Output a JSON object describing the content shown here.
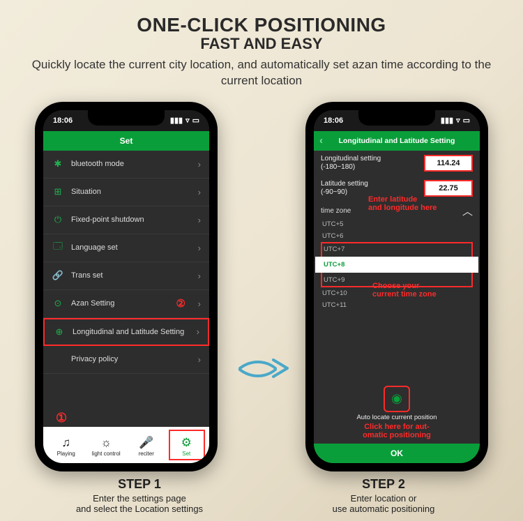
{
  "header": {
    "title": "ONE-CLICK POSITIONING",
    "subtitle": "FAST AND EASY",
    "description": "Quickly locate the current city location, and automatically set azan time according to the current location"
  },
  "phone1": {
    "time": "18:06",
    "screenTitle": "Set",
    "items": [
      {
        "icon": "✱",
        "label": "bluetooth mode"
      },
      {
        "icon": "⊞",
        "label": "Situation"
      },
      {
        "icon": "⏻",
        "label": "Fixed-point shutdown"
      },
      {
        "icon": "🗔",
        "label": "Language set"
      },
      {
        "icon": "🔗",
        "label": "Trans set"
      },
      {
        "icon": "⊙",
        "label": "Azan Setting"
      },
      {
        "icon": "⊕",
        "label": "Longitudinal and Latitude Setting"
      },
      {
        "icon": "",
        "label": "Privacy policy"
      }
    ],
    "annot2": "②",
    "annot1": "①",
    "tabs": [
      {
        "icon": "♫",
        "label": "Playing"
      },
      {
        "icon": "☼",
        "label": "light control"
      },
      {
        "icon": "🎤",
        "label": "reciter"
      },
      {
        "icon": "⚙",
        "label": "Set"
      }
    ]
  },
  "phone2": {
    "time": "18:06",
    "screenTitle": "Longitudinal and Latitude Setting",
    "lonLabel": "Longitudinal setting",
    "lonRange": "(-180~180)",
    "lonValue": "114.24",
    "latLabel": "Latitude setting",
    "latRange": "(-90~90)",
    "latValue": "22.75",
    "tzLabel": "time zone",
    "annoLatLon1": "Enter latitude",
    "annoLatLon2": "and longitude here",
    "tzItems": [
      "UTC+5",
      "UTC+6",
      "UTC+7",
      "UTC+8",
      "UTC+9",
      "UTC+10",
      "UTC+11"
    ],
    "annoTz1": "Choose your",
    "annoTz2": "current time zone",
    "autoLabel": "Auto locate current position",
    "annoAuto1": "Click here for aut-",
    "annoAuto2": "omatic positioning",
    "ok": "OK"
  },
  "steps": {
    "s1title": "STEP 1",
    "s1desc1": "Enter the settings page",
    "s1desc2": "and select the Location settings",
    "s2title": "STEP 2",
    "s2desc1": "Enter location or",
    "s2desc2": "use automatic positioning"
  }
}
